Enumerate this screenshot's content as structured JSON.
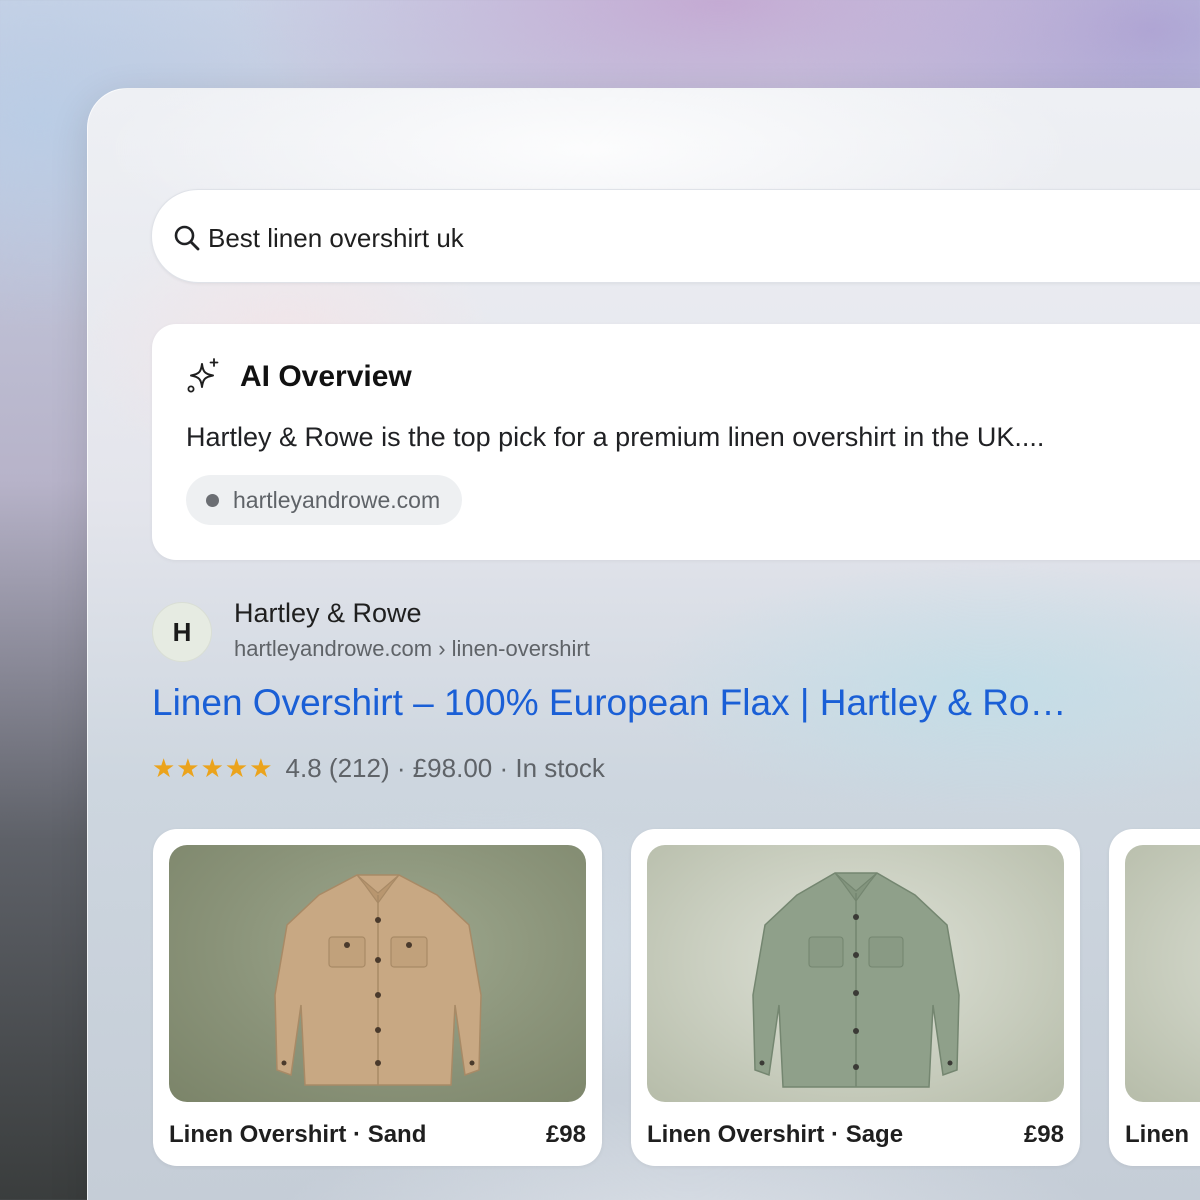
{
  "search": {
    "query": "Best linen overshirt uk",
    "icon": "search-icon"
  },
  "ai_overview": {
    "icon": "sparkle-icon",
    "title": "AI Overview",
    "text": "Hartley & Rowe is the top pick for a premium linen overshirt in the UK....",
    "source": "hartleyandrowe.com"
  },
  "result": {
    "avatar_letter": "H",
    "site_name": "Hartley & Rowe",
    "url": "hartleyandrowe.com › linen-overshirt",
    "title": "Linen Overshirt – 100% European Flax | Hartley & Ro…",
    "stars": "★★★★★",
    "rating_meta": "4.8 (212) · £98.00 · In stock",
    "link_color": "#1a5fd6",
    "star_color": "#eba31c"
  },
  "products": [
    {
      "name": "Linen Overshirt · Sand",
      "price": "£98",
      "color": "#c8a883"
    },
    {
      "name": "Linen Overshirt · Sage",
      "price": "£98",
      "color": "#8fa08a"
    },
    {
      "name": "Linen",
      "price": ""
    }
  ]
}
